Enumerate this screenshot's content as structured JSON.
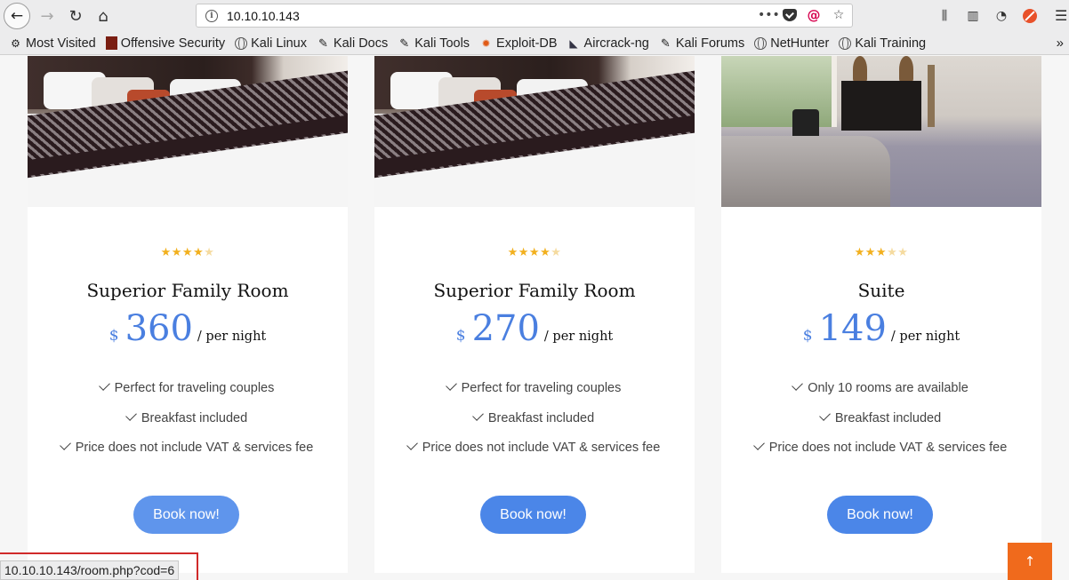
{
  "browser": {
    "url": "10.10.10.143",
    "status_url": "10.10.10.143/room.php?cod=6"
  },
  "bookmarks": [
    {
      "label": "Most Visited",
      "icon": "gear-icon"
    },
    {
      "label": "Offensive Security",
      "icon": "offsec-icon"
    },
    {
      "label": "Kali Linux",
      "icon": "globe-icon"
    },
    {
      "label": "Kali Docs",
      "icon": "kali-dragon-icon"
    },
    {
      "label": "Kali Tools",
      "icon": "kali-dragon-icon"
    },
    {
      "label": "Exploit-DB",
      "icon": "exploitdb-icon"
    },
    {
      "label": "Aircrack-ng",
      "icon": "aircrack-icon"
    },
    {
      "label": "Kali Forums",
      "icon": "kali-dragon-icon"
    },
    {
      "label": "NetHunter",
      "icon": "globe-icon"
    },
    {
      "label": "Kali Training",
      "icon": "globe-icon"
    }
  ],
  "rooms": [
    {
      "title": "Superior Family Room",
      "currency": "$",
      "price": "360",
      "per_night": "/ per night",
      "rating": 4,
      "features": [
        "Perfect for traveling couples",
        "Breakfast included",
        "Price does not include VAT & services fee"
      ],
      "button": "Book now!"
    },
    {
      "title": "Superior Family Room",
      "currency": "$",
      "price": "270",
      "per_night": "/ per night",
      "rating": 4,
      "features": [
        "Perfect for traveling couples",
        "Breakfast included",
        "Price does not include VAT & services fee"
      ],
      "button": "Book now!"
    },
    {
      "title": "Suite",
      "currency": "$",
      "price": "149",
      "per_night": "/ per night",
      "rating": 3,
      "features": [
        "Only 10 rooms are available",
        "Breakfast included",
        "Price does not include VAT & services fee"
      ],
      "button": "Book now!"
    }
  ],
  "scroll_top": "↑",
  "colors": {
    "accent": "#4b86e8",
    "star": "#f2b01e",
    "scroll_top": "#f06a1c"
  }
}
